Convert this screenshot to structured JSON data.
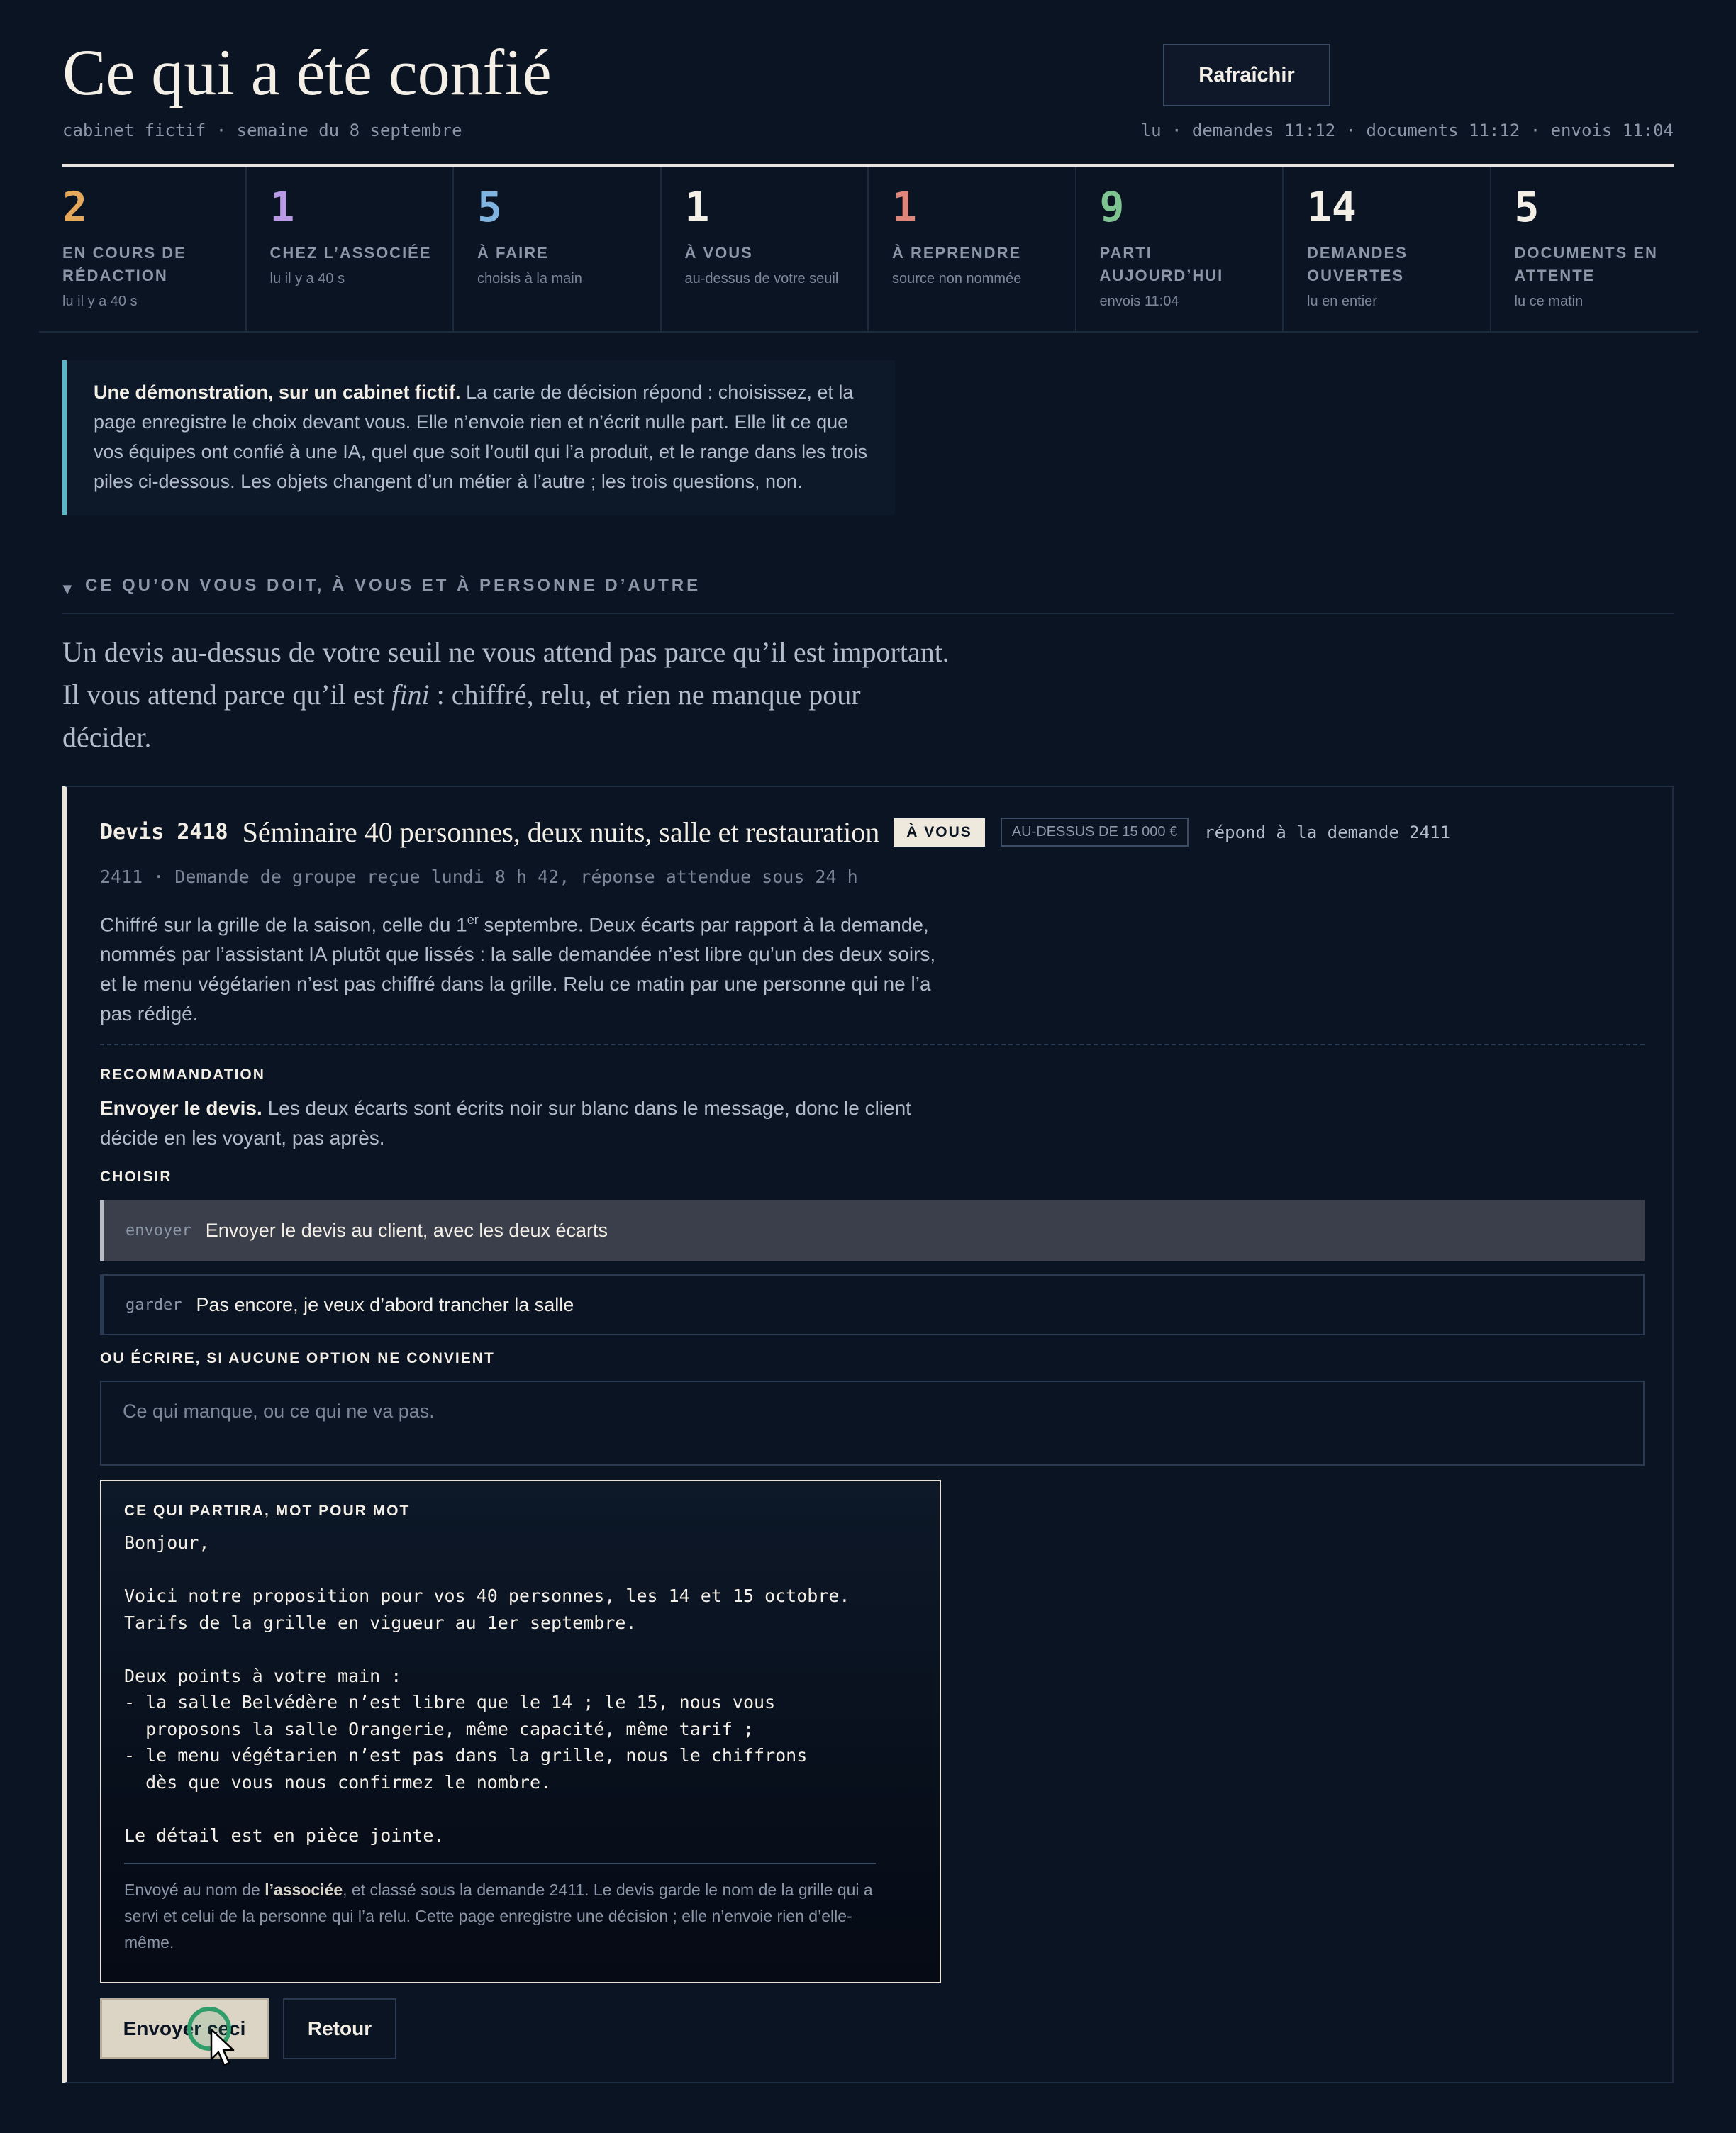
{
  "header": {
    "title": "Ce qui a été confié",
    "subtitle": "cabinet fictif · semaine du 8 septembre",
    "refresh_label": "Rafraîchir",
    "status": "lu · demandes 11:12 · documents 11:12 · envois 11:04"
  },
  "stats": [
    {
      "value": "2",
      "label": "En cours de rédaction",
      "note": "lu il y a 40 s",
      "color": "#e6a85a"
    },
    {
      "value": "1",
      "label": "Chez l’associée",
      "note": "lu il y a 40 s",
      "color": "#b99ae6"
    },
    {
      "value": "5",
      "label": "À faire",
      "note": "choisis à la main",
      "color": "#7fb3e0"
    },
    {
      "value": "1",
      "label": "À vous",
      "note": "au-dessus de votre seuil",
      "color": "#f3efe6"
    },
    {
      "value": "1",
      "label": "À reprendre",
      "note": "source non nommée",
      "color": "#e0857a"
    },
    {
      "value": "9",
      "label": "Parti aujourd’hui",
      "note": "envois 11:04",
      "color": "#7dc490"
    },
    {
      "value": "14",
      "label": "Demandes ouvertes",
      "note": "lu en entier",
      "color": "#f3efe6"
    },
    {
      "value": "5",
      "label": "Documents en attente",
      "note": "lu ce matin",
      "color": "#f3efe6"
    }
  ],
  "intro": {
    "bold": "Une démonstration, sur un cabinet fictif.",
    "text": " La carte de décision répond : choisissez, et la page enregistre le choix devant vous. Elle n’envoie rien et n’écrit nulle part. Elle lit ce que vos équipes ont confié à une IA, quel que soit l’outil qui l’a produit, et le range dans les trois piles ci-dessous. Les objets changent d’un métier à l’autre ; les trois questions, non."
  },
  "section": {
    "heading": "CE QU’ON VOUS DOIT, À VOUS ET À PERSONNE D’AUTRE",
    "lede_before": "Un devis au-dessus de votre seuil ne vous attend pas parce qu’il est important. Il vous attend parce qu’il est ",
    "lede_em": "fini",
    "lede_after": " : chiffré, relu, et rien ne manque pour décider."
  },
  "card": {
    "id": "Devis 2418",
    "title": "Séminaire 40 personnes, deux nuits, salle et restauration",
    "badge_owner": "À VOUS",
    "badge_threshold": "AU-DESSUS DE 15 000 €",
    "reply_to": "répond à la demande 2411",
    "meta": "2411 · Demande de groupe reçue lundi 8 h 42, réponse attendue sous 24 h",
    "desc_before": "Chiffré sur la grille de la saison, celle du 1",
    "desc_sup": "er",
    "desc_after": " septembre. Deux écarts par rapport à la demande, nommés par l’assistant IA plutôt que lissés : la salle demandée n’est libre qu’un des deux soirs, et le menu végétarien n’est pas chiffré dans la grille. Relu ce matin par une personne qui ne l’a pas rédigé.",
    "reco_label": "RECOMMANDATION",
    "reco_bold": "Envoyer le devis.",
    "reco_text": " Les deux écarts sont écrits noir sur blanc dans le message, donc le client décide en les voyant, pas après.",
    "choose_label": "CHOISIR",
    "options": [
      {
        "code": "envoyer",
        "label": "Envoyer le devis au client, avec les deux écarts"
      },
      {
        "code": "garder",
        "label": "Pas encore, je veux d’abord trancher la salle"
      }
    ],
    "write_label": "OU ÉCRIRE, SI AUCUNE OPTION NE CONVIENT",
    "write_placeholder": "Ce qui manque, ou ce qui ne va pas.",
    "preview_label": "CE QUI PARTIRA, MOT POUR MOT",
    "preview_message": "Bonjour,\n\nVoici notre proposition pour vos 40 personnes, les 14 et 15 octobre.\nTarifs de la grille en vigueur au 1er septembre.\n\nDeux points à votre main :\n- la salle Belvédère n’est libre que le 14 ; le 15, nous vous\n  proposons la salle Orangerie, même capacité, même tarif ;\n- le menu végétarien n’est pas dans la grille, nous le chiffrons\n  dès que vous nous confirmez le nombre.\n\nLe détail est en pièce jointe.",
    "preview_note_before": "Envoyé au nom de ",
    "preview_note_bold": "l’associée",
    "preview_note_after": ", et classé sous la demande 2411. Le devis garde le nom de la grille qui a servi et celui de la personne qui l’a relu. Cette page enregistre une décision ; elle n’envoie rien d’elle-même.",
    "send_label": "Envoyer ceci",
    "back_label": "Retour"
  }
}
